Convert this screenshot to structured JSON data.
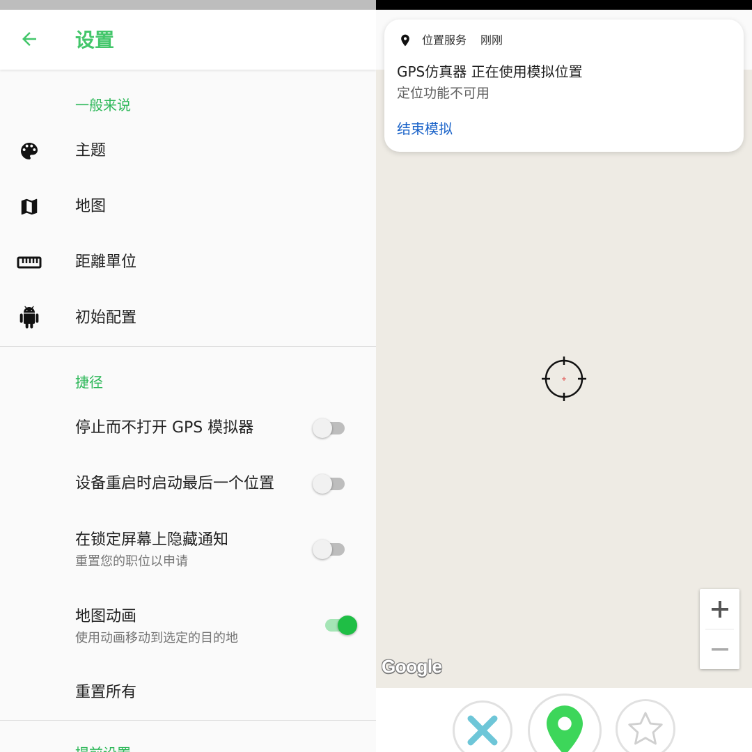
{
  "settings": {
    "title": "设置",
    "accent_color": "#43c66a",
    "sections": [
      {
        "header": "一般来说",
        "items": [
          {
            "label": "主题",
            "icon": "palette-icon"
          },
          {
            "label": "地图",
            "icon": "map-icon"
          },
          {
            "label": "距離單位",
            "icon": "ruler-icon"
          },
          {
            "label": "初始配置",
            "icon": "android-icon"
          }
        ]
      },
      {
        "header": "捷径",
        "items": [
          {
            "label": "停止而不打开 GPS 模拟器",
            "toggle": false
          },
          {
            "label": "设备重启时启动最后一个位置",
            "toggle": false
          },
          {
            "label": "在锁定屏幕上隐藏通知",
            "sub": "重置您的职位以申请",
            "toggle": false
          },
          {
            "label": "地图动画",
            "sub": "使用动画移动到选定的目的地",
            "toggle": true
          },
          {
            "label": "重置所有"
          }
        ]
      },
      {
        "header": "提前设置"
      }
    ]
  },
  "notification": {
    "app_name": "位置服务",
    "time": "刚刚",
    "title": "GPS仿真器 正在使用模拟位置",
    "body": "定位功能不可用",
    "action": "结束模拟",
    "action_color": "#1a63c9"
  },
  "map": {
    "attribution": "Google",
    "zoom_in_label": "+",
    "zoom_out_label": "−",
    "background_color": "#eeebe4"
  },
  "bottom_actions": {
    "cancel_icon": "close-icon",
    "cancel_color": "#6ec6d8",
    "pin_icon": "location-pin-icon",
    "pin_color": "#3dd65a",
    "favorite_icon": "star-outline-icon"
  }
}
